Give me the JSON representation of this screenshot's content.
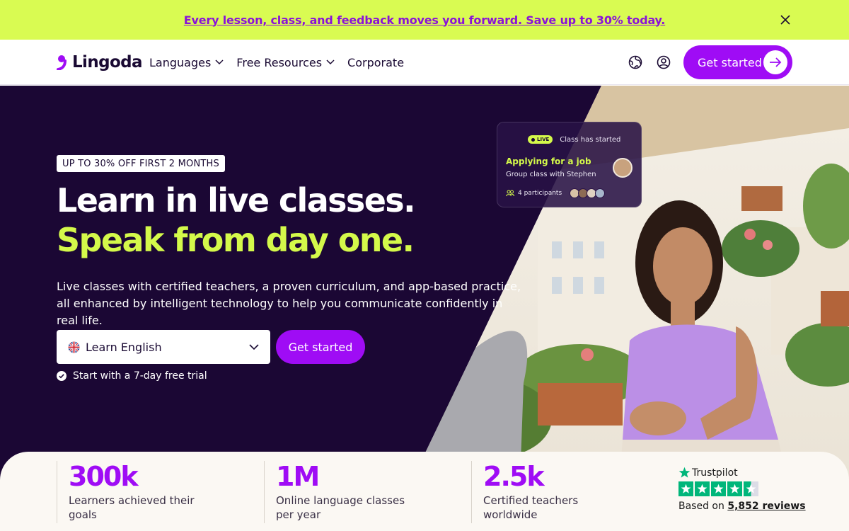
{
  "banner": {
    "text": "Every lesson, class, and feedback moves you forward. Save up to 30% today.",
    "close_icon": "close-icon"
  },
  "header": {
    "logo_text": "Lingoda",
    "nav": [
      {
        "label": "Languages",
        "has_dropdown": true
      },
      {
        "label": "Free Resources",
        "has_dropdown": true
      },
      {
        "label": "Corporate",
        "has_dropdown": false
      }
    ],
    "cta_label": "Get started",
    "icons": [
      "globe-icon",
      "user-icon",
      "arrow-right-icon"
    ]
  },
  "hero": {
    "badge": "UP TO 30% OFF FIRST 2 MONTHS",
    "title_white": "Learn in live classes.",
    "title_accent_1": "Speak",
    "title_accent_2": "from day one.",
    "subtitle": "Live classes with certified teachers, a proven curriculum, and app-based practice, all enhanced by intelligent technology to help you communicate confidently in real life.",
    "language_select": "Learn English",
    "cta_label": "Get started",
    "trial_text": "Start with a 7-day free trial"
  },
  "live_card": {
    "live_label": "LIVE",
    "status": "Class has started",
    "title": "Applying for a job",
    "subtitle": "Group class with Stephen",
    "participants": "4 participants"
  },
  "stats": [
    {
      "value": "300k",
      "label": "Learners achieved their goals"
    },
    {
      "value": "1M",
      "label": "Online language classes per year"
    },
    {
      "value": "2.5k",
      "label": "Certified teachers worldwide"
    }
  ],
  "trustpilot": {
    "brand": "Trustpilot",
    "stars": 4.5,
    "based_on": "Based on",
    "reviews": "5,852 reviews"
  },
  "colors": {
    "banner_bg": "#d9fb52",
    "primary": "#9f0cf5",
    "hero_bg": "#1b0734",
    "accent": "#d4f94a",
    "trustpilot_green": "#00b67a"
  }
}
